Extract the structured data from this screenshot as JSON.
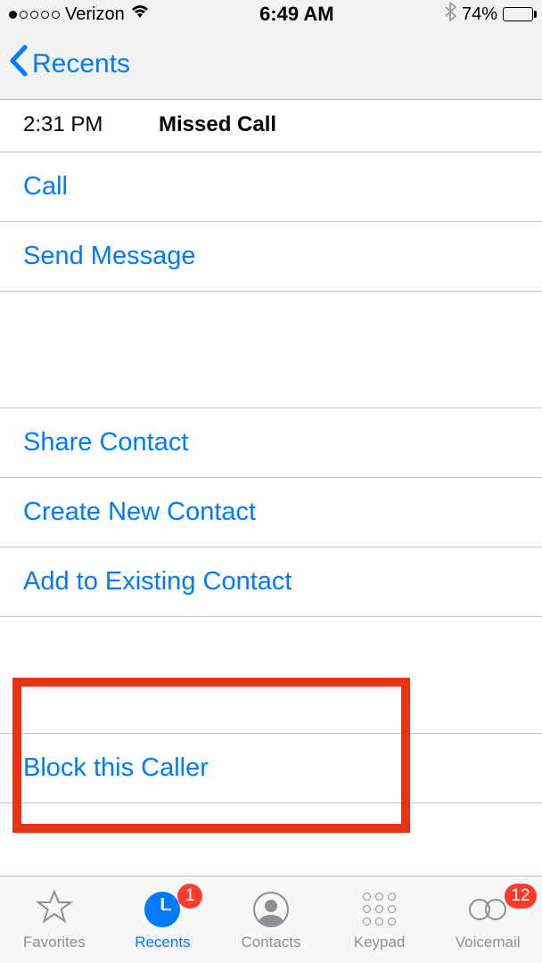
{
  "status_bar": {
    "carrier": "Verizon",
    "time": "6:49 AM",
    "battery_pct": "74%"
  },
  "nav": {
    "back_label": "Recents"
  },
  "call_info": {
    "time": "2:31 PM",
    "type": "Missed Call"
  },
  "actions": {
    "call": "Call",
    "send_message": "Send Message",
    "share_contact": "Share Contact",
    "create_contact": "Create New Contact",
    "add_existing": "Add to Existing Contact",
    "block": "Block this Caller"
  },
  "tabs": {
    "favorites": "Favorites",
    "recents": "Recents",
    "contacts": "Contacts",
    "keypad": "Keypad",
    "voicemail": "Voicemail",
    "recents_badge": "1",
    "voicemail_badge": "12"
  }
}
